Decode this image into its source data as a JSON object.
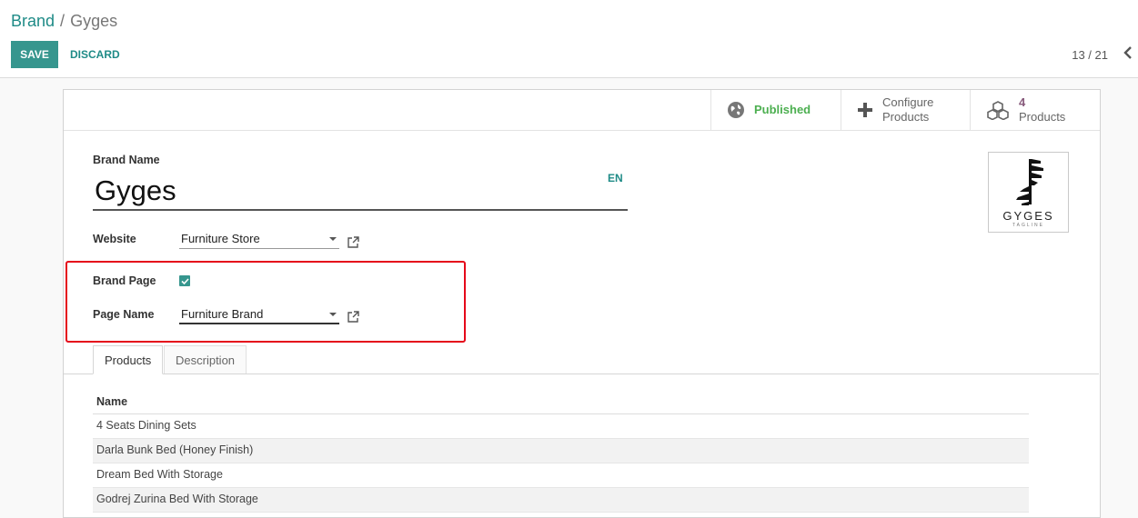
{
  "breadcrumb": {
    "parent": "Brand",
    "separator": "/",
    "current": "Gyges"
  },
  "toolbar": {
    "save_label": "SAVE",
    "discard_label": "DISCARD"
  },
  "pager": {
    "value": "13 / 21"
  },
  "stat_buttons": {
    "published": "Published",
    "configure_line1": "Configure",
    "configure_line2": "Products",
    "products_count": "4",
    "products_label": "Products"
  },
  "form": {
    "brand_name_label": "Brand Name",
    "brand_name_value": "Gyges",
    "lang": "EN",
    "website_label": "Website",
    "website_value": "Furniture Store",
    "brand_page_label": "Brand Page",
    "brand_page_checked": true,
    "page_name_label": "Page Name",
    "page_name_value": "Furniture Brand"
  },
  "logo": {
    "word": "GYGES",
    "tagline": "TAGLINE"
  },
  "tabs": [
    {
      "label": "Products",
      "active": true
    },
    {
      "label": "Description",
      "active": false
    }
  ],
  "products_table": {
    "header": "Name",
    "rows": [
      "4 Seats Dining Sets",
      "Darla Bunk Bed (Honey Finish)",
      "Dream Bed With Storage",
      "Godrej Zurina Bed With Storage"
    ]
  },
  "colors": {
    "accent": "#36968e",
    "link": "#1f8b87",
    "highlight_box": "#e5091a",
    "published": "#4caf50",
    "count": "#875a7b"
  }
}
